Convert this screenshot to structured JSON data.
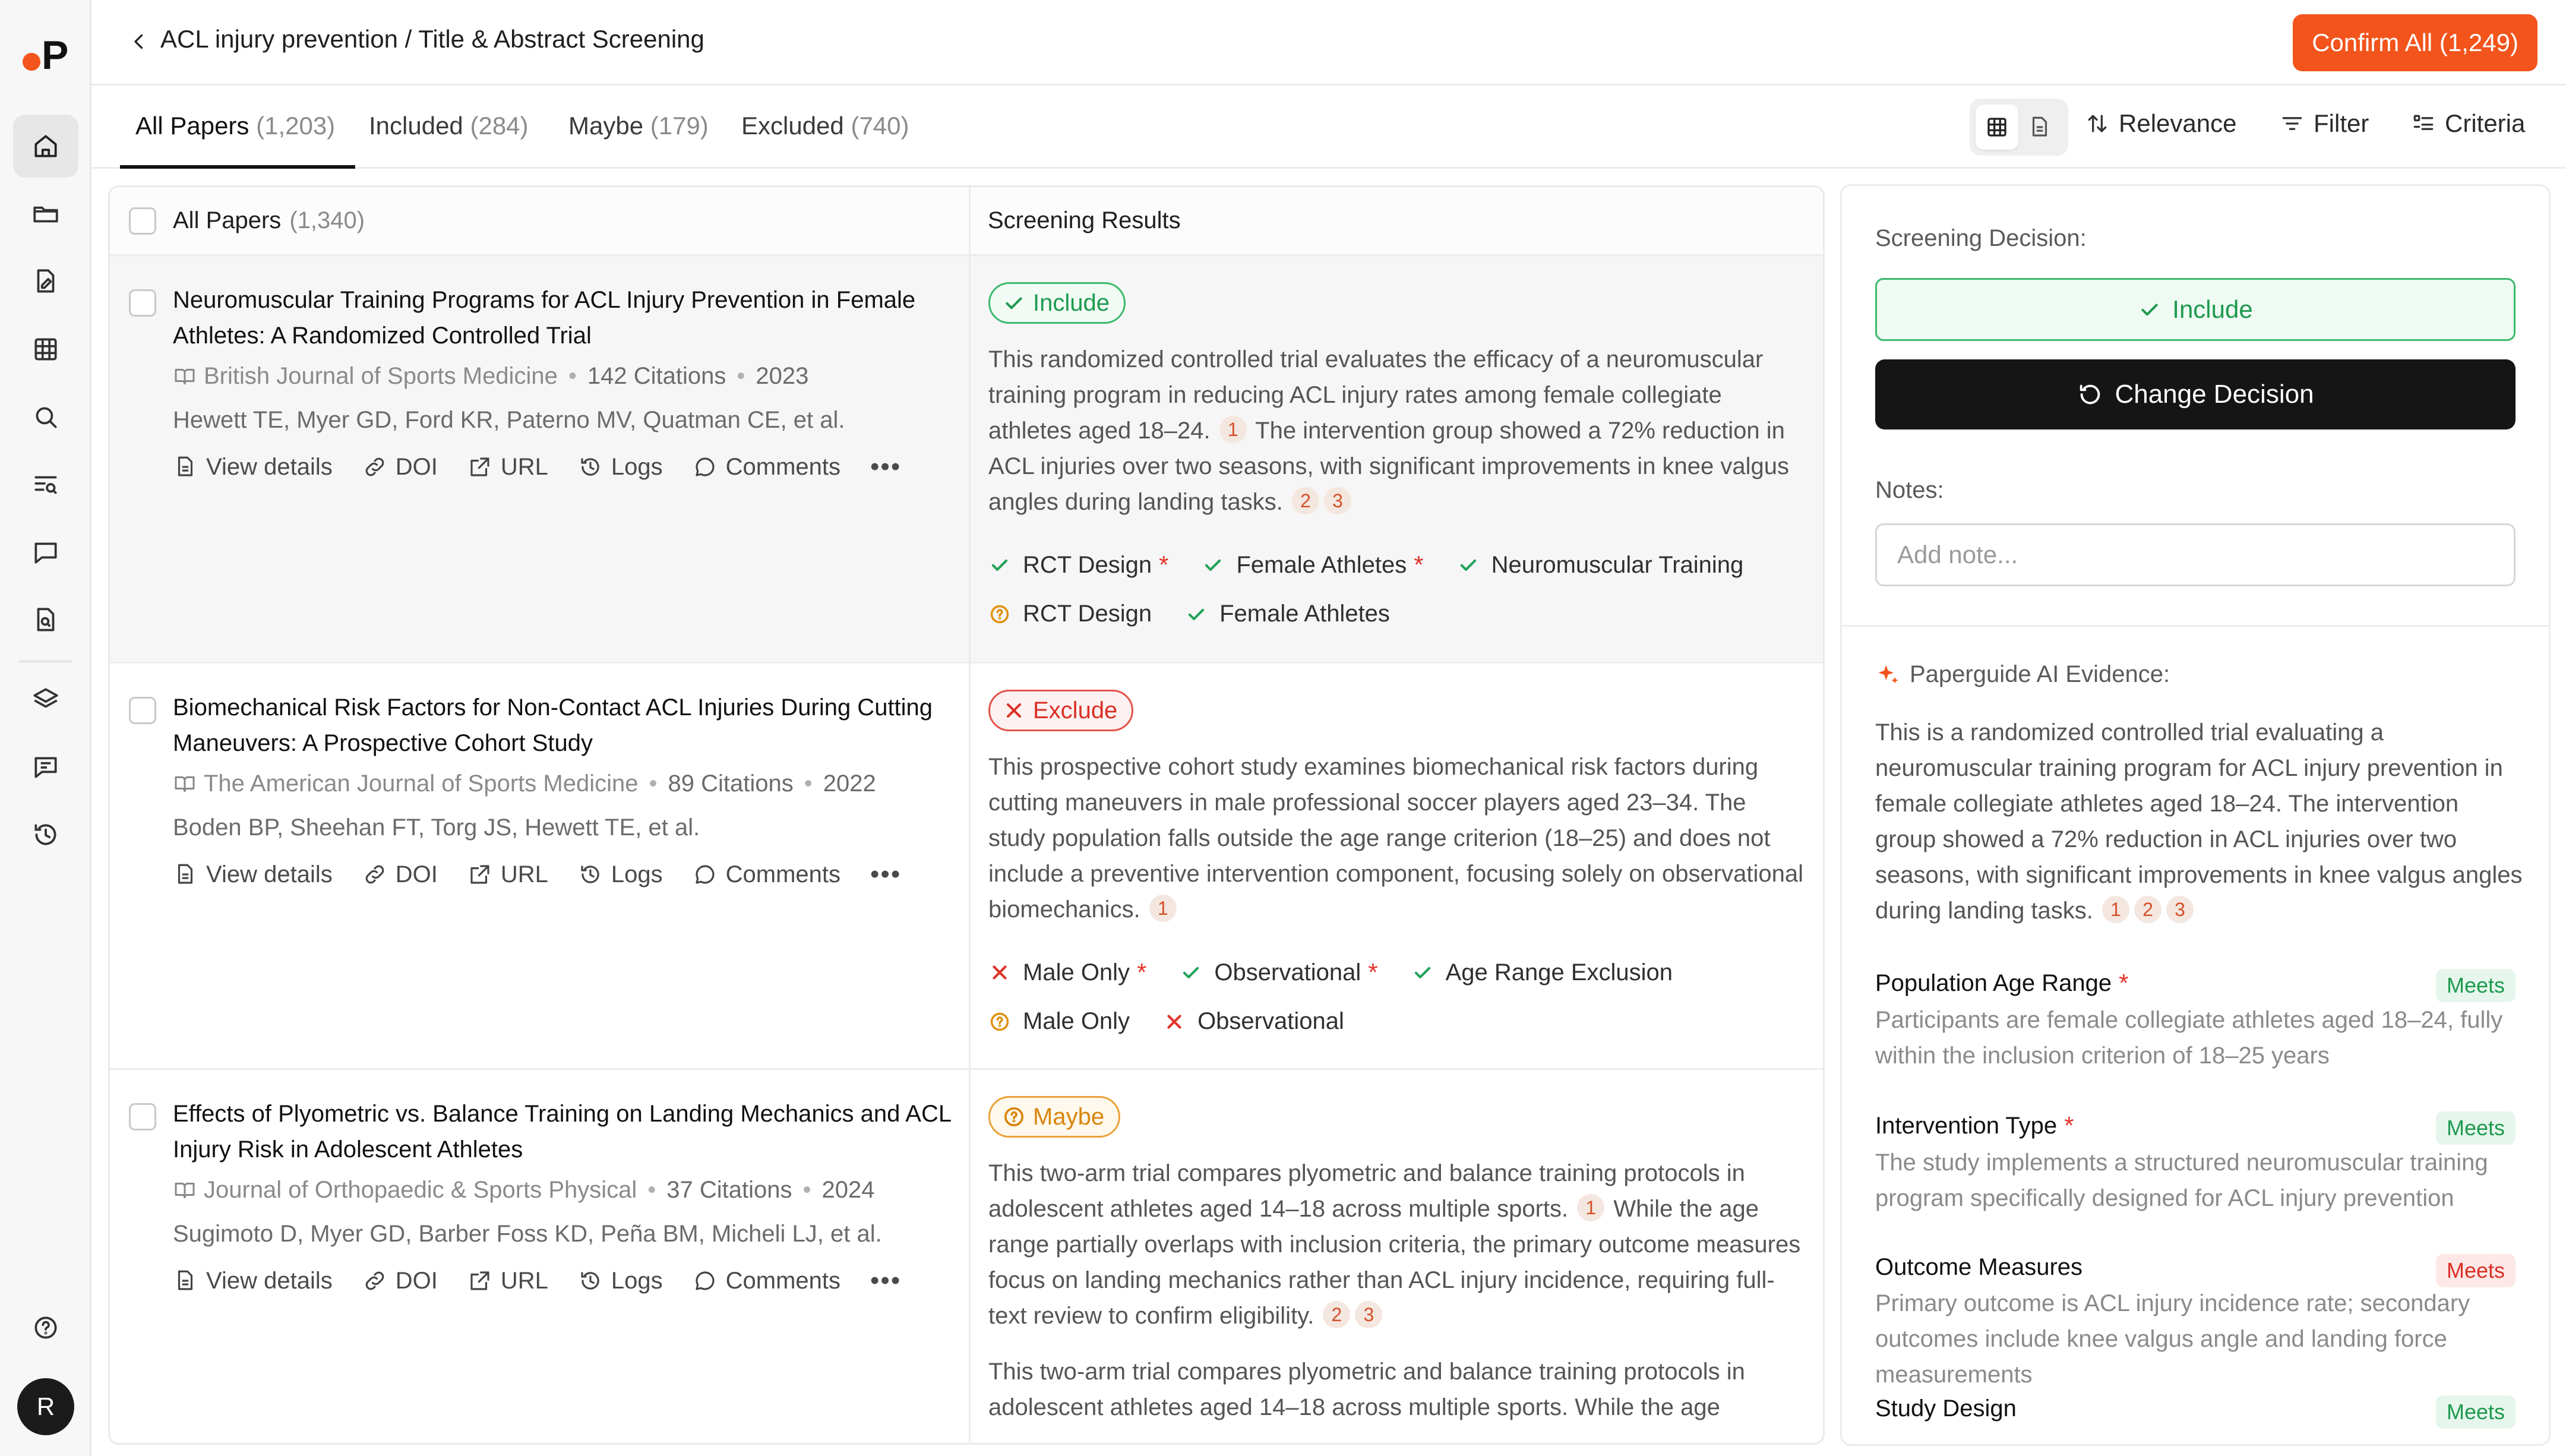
{
  "app": {
    "breadcrumb": "ACL injury prevention / Title & Abstract Screening",
    "confirm_label": "Confirm All (1,249)",
    "avatar_initial": "R",
    "accent_color": "#f2541b"
  },
  "tabs": [
    {
      "label": "All Papers",
      "count": "(1,203)"
    },
    {
      "label": "Included",
      "count": "(284)"
    },
    {
      "label": "Maybe",
      "count": "(179)"
    },
    {
      "label": "Excluded",
      "count": "(740)"
    }
  ],
  "toolbar": {
    "relevance": "Relevance",
    "filter": "Filter",
    "criteria": "Criteria"
  },
  "list": {
    "all_papers_label": "All Papers",
    "all_papers_count": "(1,340)",
    "results_header": "Screening Results",
    "actions": {
      "view_details": "View details",
      "doi": "DOI",
      "url": "URL",
      "logs": "Logs",
      "comments": "Comments",
      "more": "•••"
    }
  },
  "papers": [
    {
      "title": "Neuromuscular Training Programs for ACL Injury Prevention in Female Athletes: A Randomized Controlled Trial",
      "journal": "British Journal of Sports Medicine",
      "citations": "142 Citations",
      "year": "2023",
      "authors": "Hewett TE, Myer GD, Ford KR, Paterno MV, Quatman CE, et al.",
      "decision": "Include",
      "summary_1": "This randomized controlled trial evaluates the efficacy of a neuromuscular training program in reducing ACL injury rates among female collegiate athletes aged 18–24.",
      "summary_2": "The intervention group showed a 72% reduction in ACL injuries over two seasons, with significant improvements in knee valgus angles during landing tasks.",
      "refs": [
        "1",
        "2",
        "3"
      ],
      "criteria_row1": [
        "RCT Design",
        "Female Athletes",
        "Neuromuscular Training"
      ],
      "criteria_row2": [
        "RCT Design",
        "Female Athletes"
      ]
    },
    {
      "title": "Biomechanical Risk Factors for Non-Contact ACL Injuries During Cutting Maneuvers: A Prospective Cohort Study",
      "journal": "The American Journal of Sports Medicine",
      "citations": "89 Citations",
      "year": "2022",
      "authors": "Boden BP, Sheehan FT, Torg JS, Hewett TE, et al.",
      "decision": "Exclude",
      "summary_1": "This prospective cohort study examines biomechanical risk factors during cutting maneuvers in male professional soccer players aged 23–34. The study population falls outside the age range criterion (18–25) and does not include a preventive intervention component, focusing solely on observational biomechanics.",
      "refs": [
        "1"
      ],
      "criteria_row1": [
        "Male Only",
        "Observational",
        "Age Range Exclusion"
      ],
      "criteria_row2": [
        "Male Only",
        "Observational"
      ]
    },
    {
      "title": "Effects of Plyometric vs. Balance Training on Landing Mechanics and ACL Injury Risk in Adolescent Athletes",
      "journal": "Journal of Orthopaedic & Sports Physical",
      "citations": "37 Citations",
      "year": "2024",
      "authors": "Sugimoto D, Myer GD, Barber Foss KD, Peña BM, Micheli LJ, et al.",
      "decision": "Maybe",
      "summary_1": "This two-arm trial compares plyometric and balance training protocols in adolescent athletes aged 14–18 across multiple sports.",
      "summary_2": "While the age range partially overlaps with inclusion criteria, the primary outcome measures focus on landing mechanics rather than ACL injury incidence, requiring full-text review to confirm eligibility.",
      "summary_3": "This two-arm trial compares plyometric and balance training protocols in adolescent athletes aged 14–18 across multiple sports. While the age",
      "refs": [
        "1",
        "2",
        "3"
      ]
    }
  ],
  "decision_panel": {
    "screening_label": "Screening Decision:",
    "include_label": "Include",
    "change_label": "Change Decision",
    "notes_label": "Notes:",
    "notes_placeholder": "Add note...",
    "ai_label": "Paperguide AI Evidence:",
    "ai_text": "This is a randomized controlled trial evaluating a neuromuscular training program for ACL injury prevention in female collegiate athletes aged 18–24. The intervention group showed a 72% reduction in ACL injuries over two seasons, with significant improvements in knee valgus angles during landing tasks.",
    "ai_refs": [
      "1",
      "2",
      "3"
    ],
    "criteria": [
      {
        "title": "Population Age Range",
        "status": "Meets",
        "text": "Participants are female collegiate athletes aged 18–24, fully within the inclusion criterion of 18–25 years"
      },
      {
        "title": "Intervention Type",
        "status": "Meets",
        "text": "The study implements a structured neuromuscular training program specifically designed for ACL injury prevention"
      },
      {
        "title": "Outcome Measures",
        "status": "Meets",
        "text": "Primary outcome is ACL injury incidence rate; secondary outcomes include knee valgus angle and landing force measurements"
      },
      {
        "title": "Study Design",
        "status": "Meets",
        "text": ""
      }
    ]
  }
}
